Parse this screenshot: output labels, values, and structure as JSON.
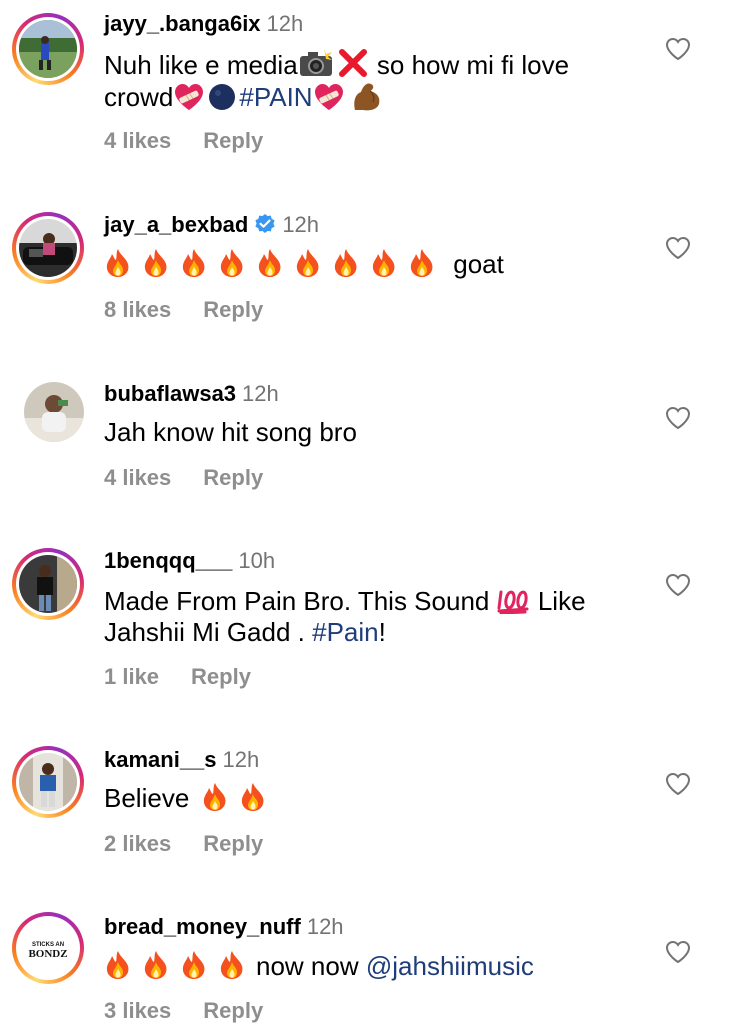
{
  "comments": [
    {
      "username": "jayy_.banga6ix",
      "time": "12h",
      "verified": false,
      "line1": "Nuh like e media",
      "line1_after": "so how mi fi love",
      "line2": "crowd",
      "hashtag": "#PAIN",
      "likes": "4 likes",
      "reply": "Reply"
    },
    {
      "username": "jay_a_bexbad",
      "time": "12h",
      "verified": true,
      "fire_count": 9,
      "text_after": "goat",
      "likes": "8 likes",
      "reply": "Reply"
    },
    {
      "username": "bubaflawsa3",
      "time": "12h",
      "verified": false,
      "text": "Jah know hit song bro",
      "likes": "4 likes",
      "reply": "Reply"
    },
    {
      "username": "1benqqq___",
      "time": "10h",
      "verified": false,
      "line1": "Made From Pain Bro. This Sound",
      "line1_after": "Like",
      "line2": "Jahshii Mi Gadd .",
      "hashtag": "#Pain",
      "line2_end": "!",
      "likes": "1 like",
      "reply": "Reply"
    },
    {
      "username": "kamani__s",
      "time": "12h",
      "verified": false,
      "text": "Believe",
      "fire_count": 2,
      "likes": "2 likes",
      "reply": "Reply"
    },
    {
      "username": "bread_money_nuff",
      "time": "12h",
      "verified": false,
      "fire_count": 4,
      "text_after": "now now",
      "mention": "@jahshiimusic",
      "likes": "3 likes",
      "reply": "Reply",
      "avatar_text_top": "STICKS AN",
      "avatar_text_bottom": "BONDZ"
    }
  ],
  "icons": {
    "like": "heart-outline-icon",
    "verified": "verified-badge-icon",
    "fire": "fire-emoji",
    "camera": "camera-flash-emoji",
    "cross": "cross-mark-emoji",
    "heart": "mending-heart-emoji",
    "circle": "dark-circle-emoji",
    "muscle": "flexed-biceps-emoji",
    "hundred": "hundred-points-emoji"
  },
  "colors": {
    "link": "#1f3d7a",
    "meta": "#8e8e8e",
    "time": "#737373",
    "verified": "#3897f0"
  }
}
